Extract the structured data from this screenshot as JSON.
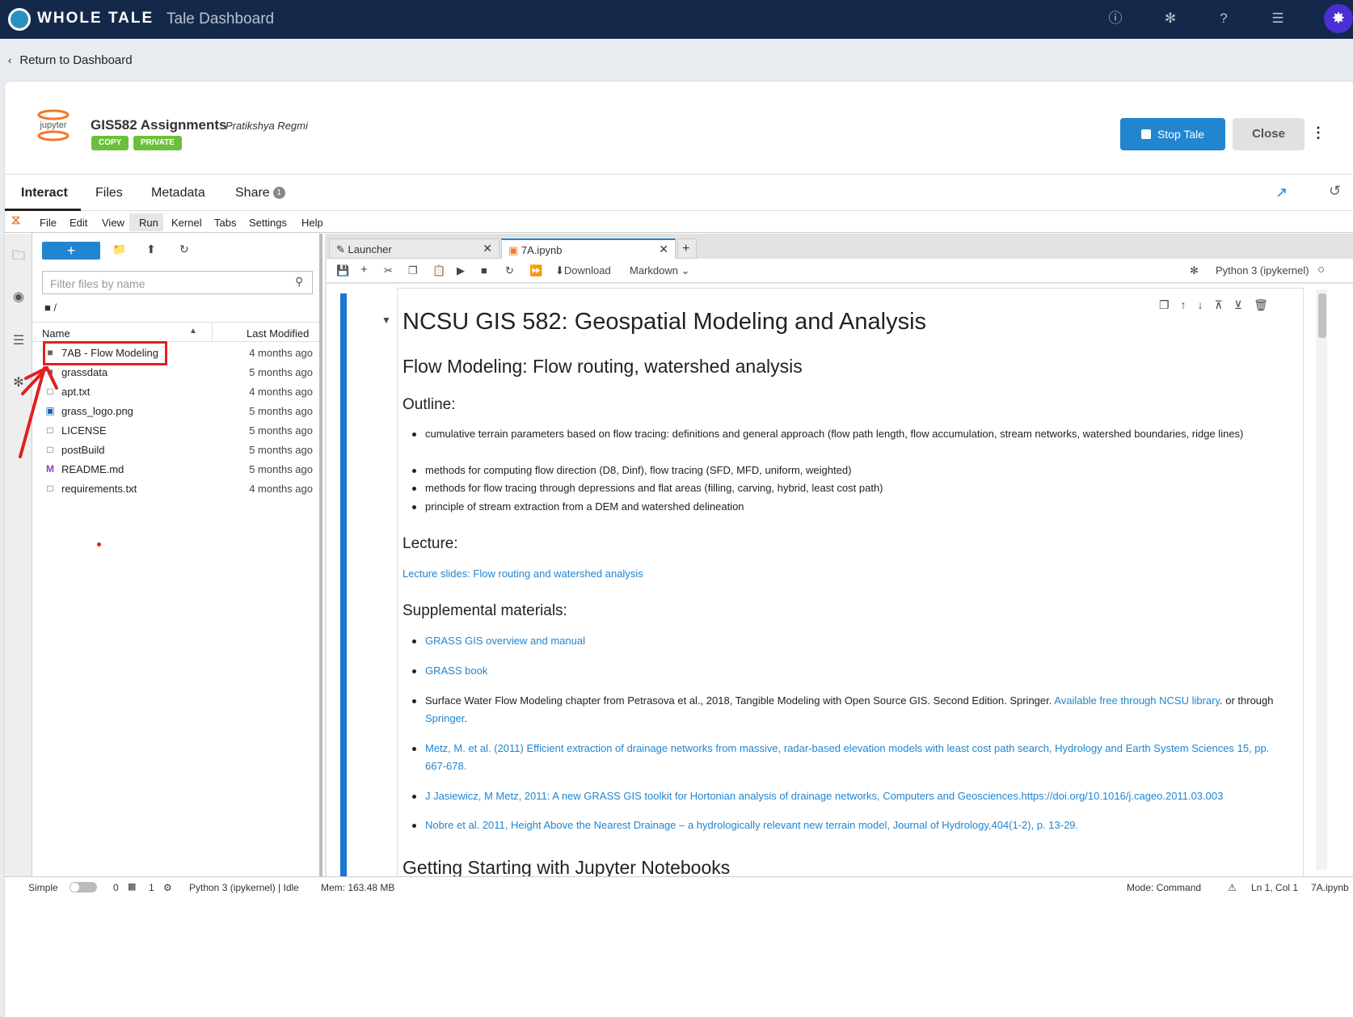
{
  "topnav": {
    "brand": "WHOLE TALE",
    "title": "Tale Dashboard",
    "icons": [
      "info-icon",
      "bug-icon",
      "help-icon",
      "tasks-icon"
    ]
  },
  "return_link": "Return to Dashboard",
  "tale": {
    "logo_text": "jupyter",
    "title": "GIS582 Assignments",
    "author": "Pratikshya Regmi",
    "badges": [
      "COPY",
      "PRIVATE"
    ],
    "stop_label": "Stop Tale",
    "close_label": "Close"
  },
  "main_tabs": {
    "interact": "Interact",
    "files": "Files",
    "metadata": "Metadata",
    "share": "Share",
    "share_count": "1"
  },
  "jupyter_menu": [
    "File",
    "Edit",
    "View",
    "Run",
    "Kernel",
    "Tabs",
    "Settings",
    "Help"
  ],
  "file_browser": {
    "new_label": "+",
    "filter_placeholder": "Filter files by name",
    "breadcrumb": "/",
    "col_name": "Name",
    "col_modified": "Last Modified",
    "files": [
      {
        "name": "7AB - Flow Modeling",
        "modified": "4 months ago",
        "type": "folder"
      },
      {
        "name": "grassdata",
        "modified": "5 months ago",
        "type": "folder"
      },
      {
        "name": "apt.txt",
        "modified": "4 months ago",
        "type": "file"
      },
      {
        "name": "grass_logo.png",
        "modified": "5 months ago",
        "type": "image"
      },
      {
        "name": "LICENSE",
        "modified": "5 months ago",
        "type": "file"
      },
      {
        "name": "postBuild",
        "modified": "5 months ago",
        "type": "file"
      },
      {
        "name": "README.md",
        "modified": "5 months ago",
        "type": "markdown"
      },
      {
        "name": "requirements.txt",
        "modified": "4 months ago",
        "type": "file"
      }
    ]
  },
  "notebook_tabs": {
    "launcher": "Launcher",
    "notebook": "7A.ipynb"
  },
  "toolbar": {
    "download": "Download",
    "cell_type": "Markdown",
    "kernel": "Python 3 (ipykernel)"
  },
  "notebook": {
    "h1": "NCSU GIS 582: Geospatial Modeling and Analysis",
    "h2": "Flow Modeling: Flow routing, watershed analysis",
    "outline_heading": "Outline:",
    "outline": [
      "cumulative terrain parameters based on flow tracing: definitions and general approach (flow path length, flow accumulation, stream networks, watershed boundaries, ridge lines)",
      "methods for computing flow direction (D8, Dinf), flow tracing (SFD, MFD, uniform, weighted)",
      "methods for flow tracing through depressions and flat areas (filling, carving, hybrid, least cost path)",
      "principle of stream extraction from a DEM and watershed delineation"
    ],
    "lecture_heading": "Lecture:",
    "lecture_link": "Lecture slides: Flow routing and watershed analysis",
    "supp_heading": "Supplemental materials:",
    "supp": {
      "grass_manual": "GRASS GIS overview and manual",
      "grass_book": "GRASS book",
      "surface_text": "Surface Water Flow Modeling chapter from Petrasova et al., 2018, Tangible Modeling with Open Source GIS. Second Edition. Springer.",
      "ncsu_link": "Available free through NCSU library",
      "or_through": ". or through",
      "springer_link": "Springer",
      "period": ".",
      "metz": "Metz, M. et al. (2011) Efficient extraction of drainage networks from massive, radar-based elevation models with least cost path search, Hydrology and Earth System Sciences 15, pp. 667-678.",
      "jasiewicz": "J Jasiewicz, M Metz, 2011: A new GRASS GIS toolkit for Hortonian analysis of drainage networks, Computers and Geosciences.https://doi.org/10.1016/j.cageo.2011.03.003",
      "nobre": "Nobre et al. 2011, Height Above the Nearest Drainage – a hydrologically relevant new terrain model, Journal of Hydrology,404(1-2), p. 13-29."
    },
    "next_heading": "Getting Starting with Jupyter Notebooks"
  },
  "statusbar": {
    "simple": "Simple",
    "zero": "0",
    "one": "1",
    "kernel_status": "Python 3 (ipykernel) | Idle",
    "mem": "Mem: 163.48 MB",
    "mode": "Mode: Command",
    "position": "Ln 1, Col 1",
    "file": "7A.ipynb"
  },
  "colors": {
    "nav_bg": "#14294a",
    "accent": "#2185d0",
    "badge_green": "#6cbf3a",
    "annotation_red": "#e02020"
  }
}
